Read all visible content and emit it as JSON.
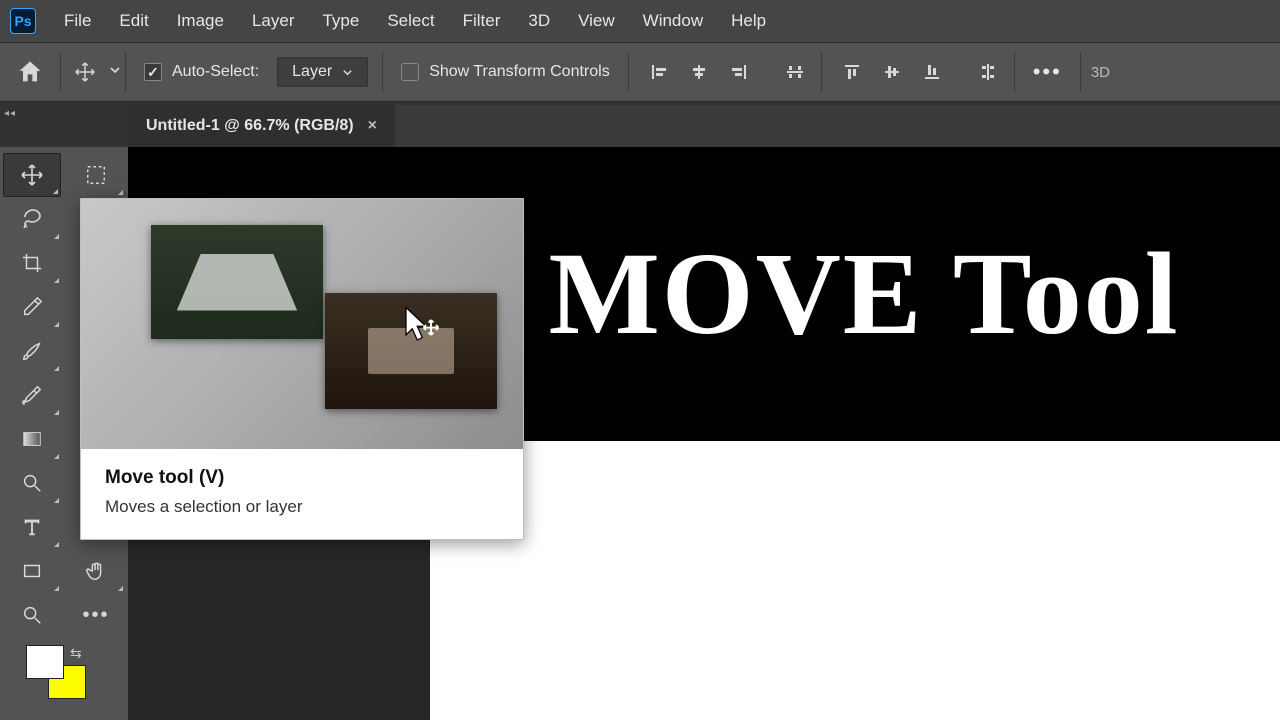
{
  "menubar": {
    "items": [
      "File",
      "Edit",
      "Image",
      "Layer",
      "Type",
      "Select",
      "Filter",
      "3D",
      "View",
      "Window",
      "Help"
    ]
  },
  "optionsbar": {
    "autoselect_label": "Auto-Select:",
    "autoselect_checked": true,
    "dropdown_value": "Layer",
    "show_transform_label": "Show Transform Controls",
    "show_transform_checked": false,
    "threeD_label": "3D"
  },
  "document_tab": {
    "title": "Untitled-1 @ 66.7% (RGB/8)",
    "close_glyph": "×"
  },
  "canvas": {
    "headline": "MOVE Tool"
  },
  "tooltip": {
    "title": "Move tool (V)",
    "desc": "Moves a selection or layer"
  },
  "tools": {
    "row1": [
      "move-tool",
      "rectangular-marquee-tool"
    ],
    "row2": [
      "lasso-tool",
      ""
    ],
    "row3": [
      "crop-tool",
      ""
    ],
    "row4": [
      "eyedropper-tool",
      ""
    ],
    "row5": [
      "brush-tool",
      ""
    ],
    "row6": [
      "healing-brush-tool",
      ""
    ],
    "row7": [
      "gradient-tool",
      ""
    ],
    "row8": [
      "zoom-blur-tool",
      ""
    ],
    "row9": [
      "type-tool",
      ""
    ],
    "row10": [
      "rectangle-tool",
      "hand-tool"
    ],
    "row11": [
      "zoom-tool",
      "more-tools"
    ]
  },
  "swatches": {
    "fg": "#ffffff",
    "bg": "#fdfd00"
  }
}
